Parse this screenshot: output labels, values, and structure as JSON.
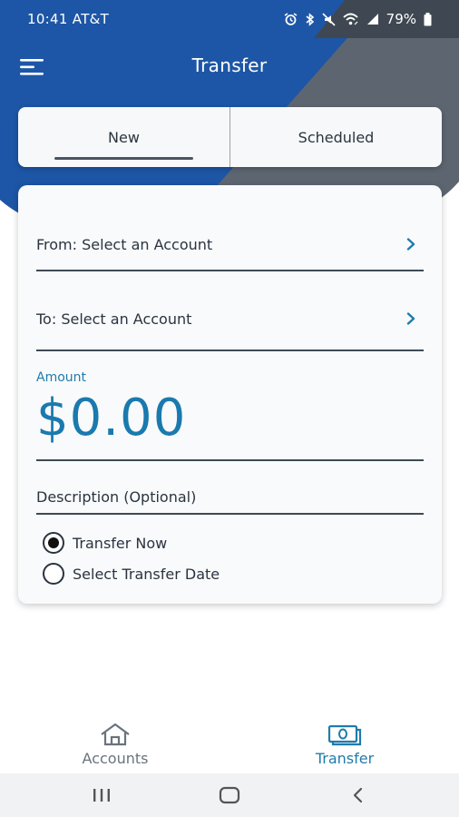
{
  "status_bar": {
    "time_carrier": "10:41 AT&T",
    "battery": "79%",
    "icons": [
      "alarm-icon",
      "bluetooth-icon",
      "mute-icon",
      "wifi-icon",
      "signal-icon",
      "battery-icon"
    ]
  },
  "header": {
    "title": "Transfer",
    "menu_icon": "hamburger-menu-icon"
  },
  "tabs": [
    {
      "label": "New",
      "selected": true
    },
    {
      "label": "Scheduled",
      "selected": false
    }
  ],
  "form": {
    "from_label": "From: Select an Account",
    "to_label": "To: Select an Account",
    "amount_label": "Amount",
    "amount_value": "$0.00",
    "description_label": "Description (Optional)",
    "options": [
      {
        "label": "Transfer Now",
        "selected": true
      },
      {
        "label": "Select Transfer Date",
        "selected": false
      }
    ]
  },
  "bottom_nav": {
    "items": [
      {
        "label": "Accounts",
        "icon": "house-icon",
        "active": false
      },
      {
        "label": "Transfer",
        "icon": "money-transfer-icon",
        "active": true
      }
    ]
  },
  "colors": {
    "brand_blue": "#1d56a6",
    "header_gray": "#5d6670",
    "accent_teal": "#1f7bab",
    "text_dark": "#2a3440"
  }
}
